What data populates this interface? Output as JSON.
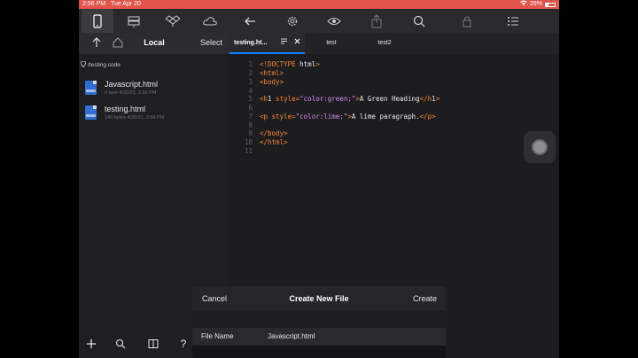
{
  "status_bar": {
    "time": "2:56 PM",
    "date": "Tue Apr 20",
    "battery": "29%",
    "battery_fraction": 0.29,
    "color": "#e2554b"
  },
  "toolbar": {
    "icons": [
      "phone-icon",
      "server-icon",
      "dropbox-icon",
      "cloud-icon",
      "back-arrow-icon",
      "gear-icon",
      "eye-icon",
      "share-icon",
      "search-icon",
      "lock-icon",
      "list-icon"
    ]
  },
  "left_panel": {
    "title": "Local",
    "select_label": "Select",
    "path": "/testing code",
    "files": [
      {
        "name": "Javascript.html",
        "meta": "0 byte 4/20/21, 2:56 PM"
      },
      {
        "name": "testing.html",
        "meta": "140 bytes 4/20/21, 2:56 PM"
      }
    ]
  },
  "bottom_bar": {
    "icons": [
      "add-icon",
      "search-icon",
      "book-icon",
      "help-icon"
    ],
    "help_label": "?"
  },
  "tabs": [
    {
      "label": "testing.ht...",
      "active": true
    },
    {
      "label": "test",
      "active": false
    },
    {
      "label": "test2",
      "active": false
    }
  ],
  "editor": {
    "line_numbers": [
      "1",
      "2",
      "3",
      "4",
      "5",
      "6",
      "7",
      "8",
      "9",
      "10",
      "11"
    ],
    "lines": [
      "<!DOCTYPE html>",
      "<html>",
      "<body>",
      "",
      "<h1 style=\"color:green;\">A Green Heading</h1>",
      "",
      "<p style=\"color:lime;\">A lime paragraph.</p>",
      "",
      "</body>",
      "</html>",
      ""
    ]
  },
  "modal": {
    "cancel_label": "Cancel",
    "title": "Create New File",
    "create_label": "Create",
    "field_label": "File Name",
    "field_value": "Javascript.html"
  },
  "colors": {
    "accent": "#0a84ff",
    "tag": "#f0833a",
    "string": "#d08cf0"
  }
}
